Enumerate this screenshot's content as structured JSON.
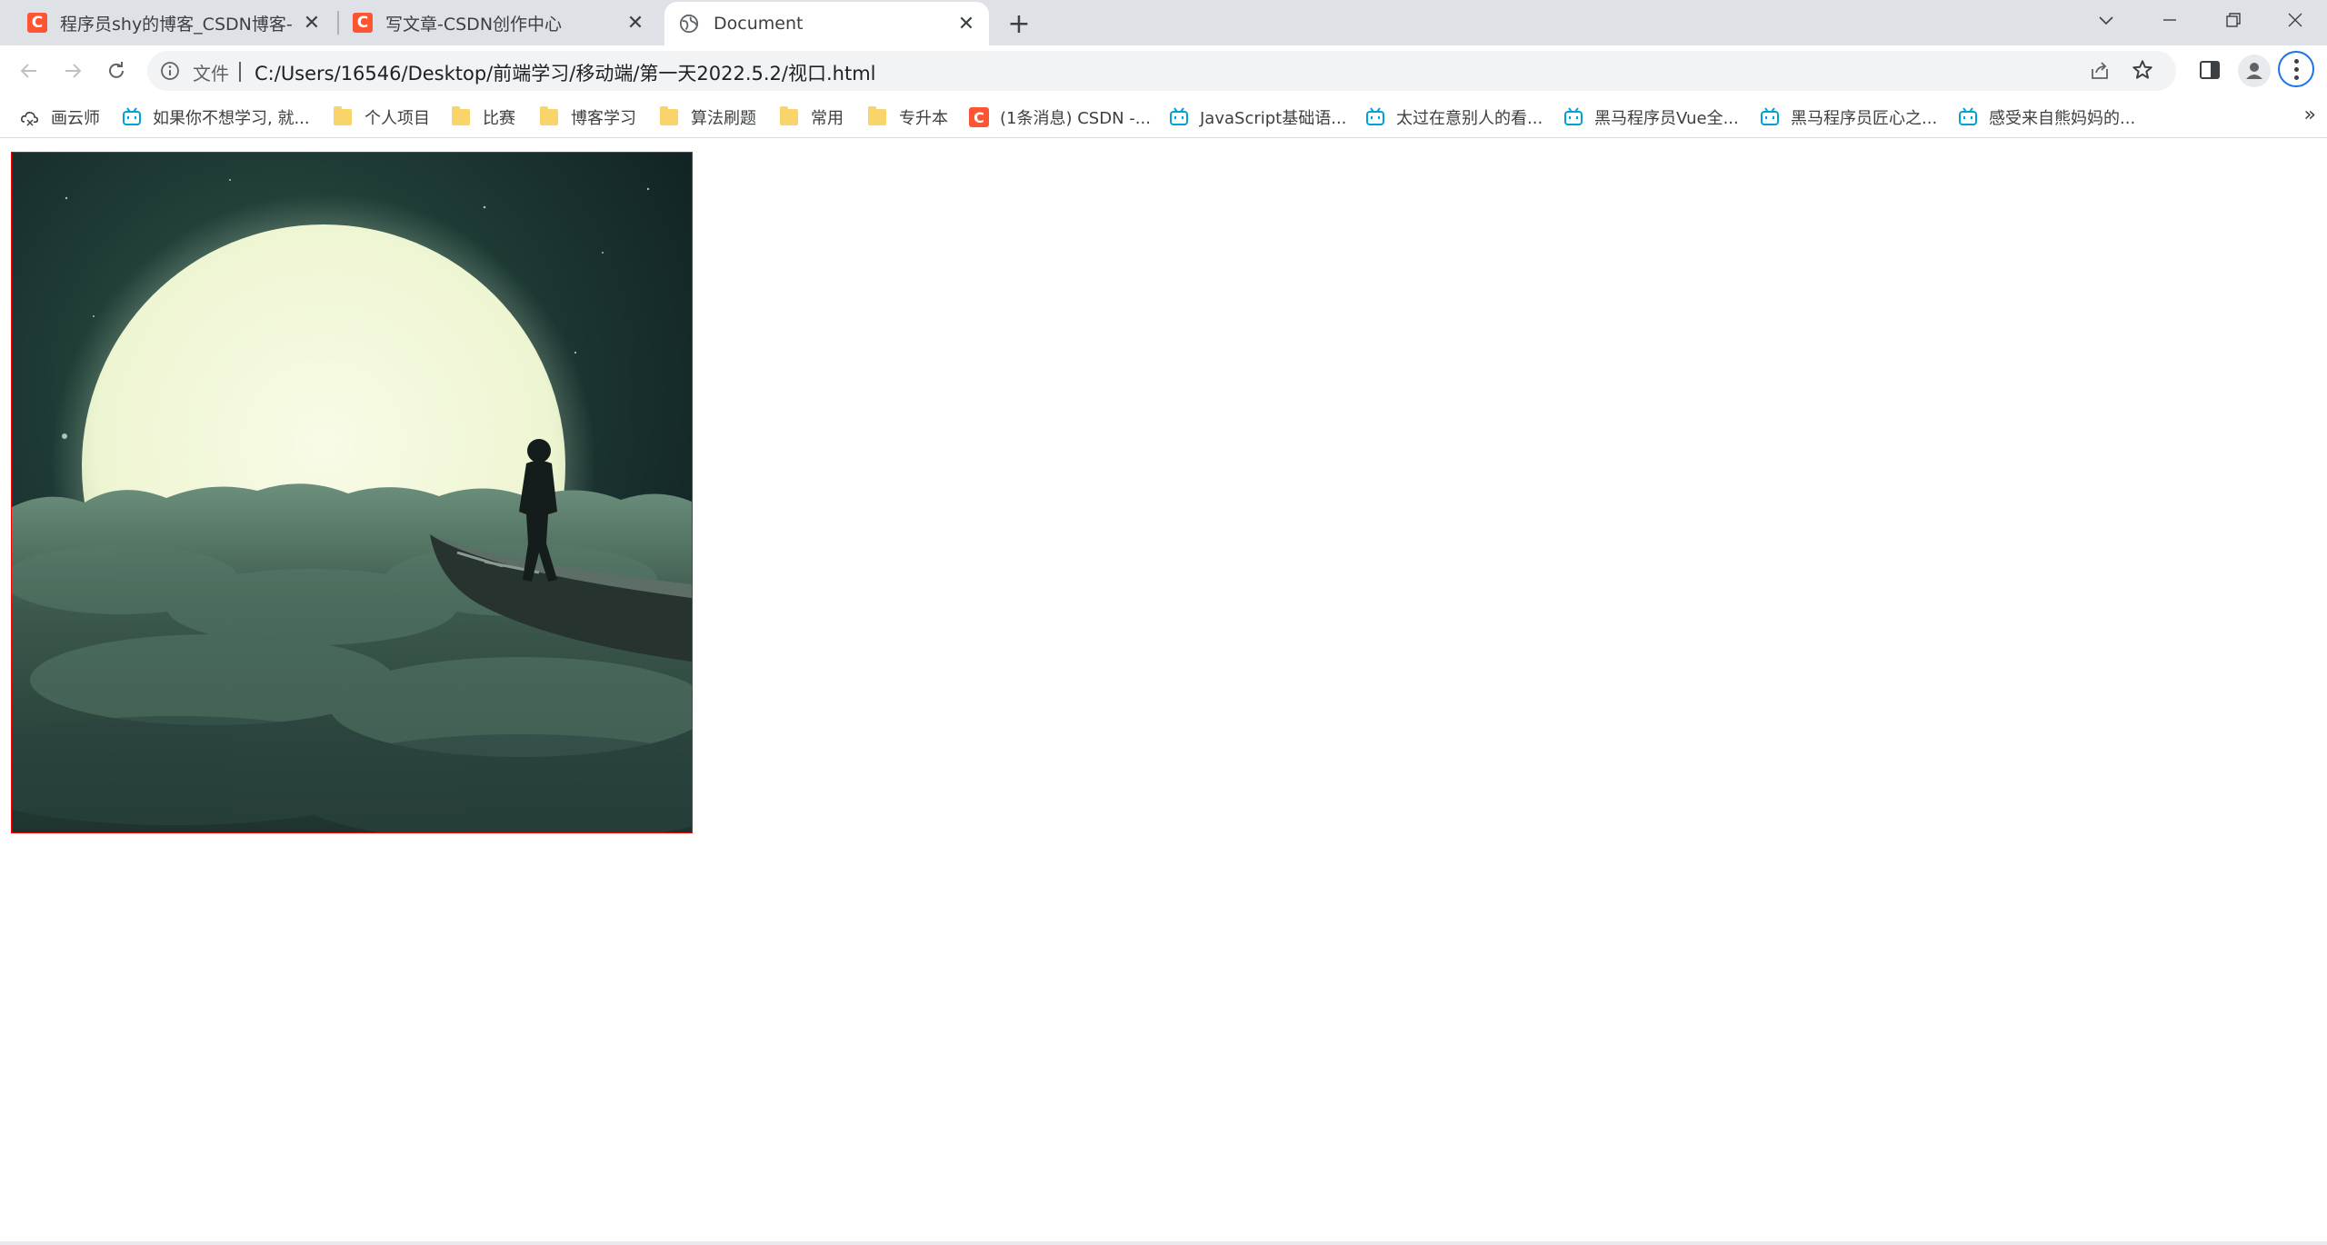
{
  "tabs": [
    {
      "title": "程序员shy的博客_CSDN博客-《",
      "favicon": "C",
      "active": false
    },
    {
      "title": "写文章-CSDN创作中心",
      "favicon": "C",
      "active": false
    },
    {
      "title": "Document",
      "favicon": "globe-icon",
      "active": true
    }
  ],
  "toolbar": {
    "security_label": "文件",
    "url": "C:/Users/16546/Desktop/前端学习/移动端/第一天2022.5.2/视口.html"
  },
  "bookmarks": [
    {
      "label": "画云师",
      "icon": "cloud-icon"
    },
    {
      "label": "如果你不想学习, 就...",
      "icon": "bilibili-icon"
    },
    {
      "label": "个人项目",
      "icon": "folder-icon"
    },
    {
      "label": "比赛",
      "icon": "folder-icon"
    },
    {
      "label": "博客学习",
      "icon": "folder-icon"
    },
    {
      "label": "算法刷题",
      "icon": "folder-icon"
    },
    {
      "label": "常用",
      "icon": "folder-icon"
    },
    {
      "label": "专升本",
      "icon": "folder-icon"
    },
    {
      "label": "(1条消息) CSDN -...",
      "icon": "csdn-icon"
    },
    {
      "label": "JavaScript基础语...",
      "icon": "bilibili-icon"
    },
    {
      "label": "太过在意别人的看...",
      "icon": "bilibili-icon"
    },
    {
      "label": "黑马程序员Vue全...",
      "icon": "bilibili-icon"
    },
    {
      "label": "黑马程序员匠心之...",
      "icon": "bilibili-icon"
    },
    {
      "label": "感受来自熊妈妈的...",
      "icon": "bilibili-icon"
    }
  ],
  "colors": {
    "tabstrip": "#dee1e6",
    "csdn_brand": "#fc5531",
    "bilibili_blue": "#00a1d6",
    "image_border": "#ff0000",
    "focus_ring": "#1a73e8"
  }
}
